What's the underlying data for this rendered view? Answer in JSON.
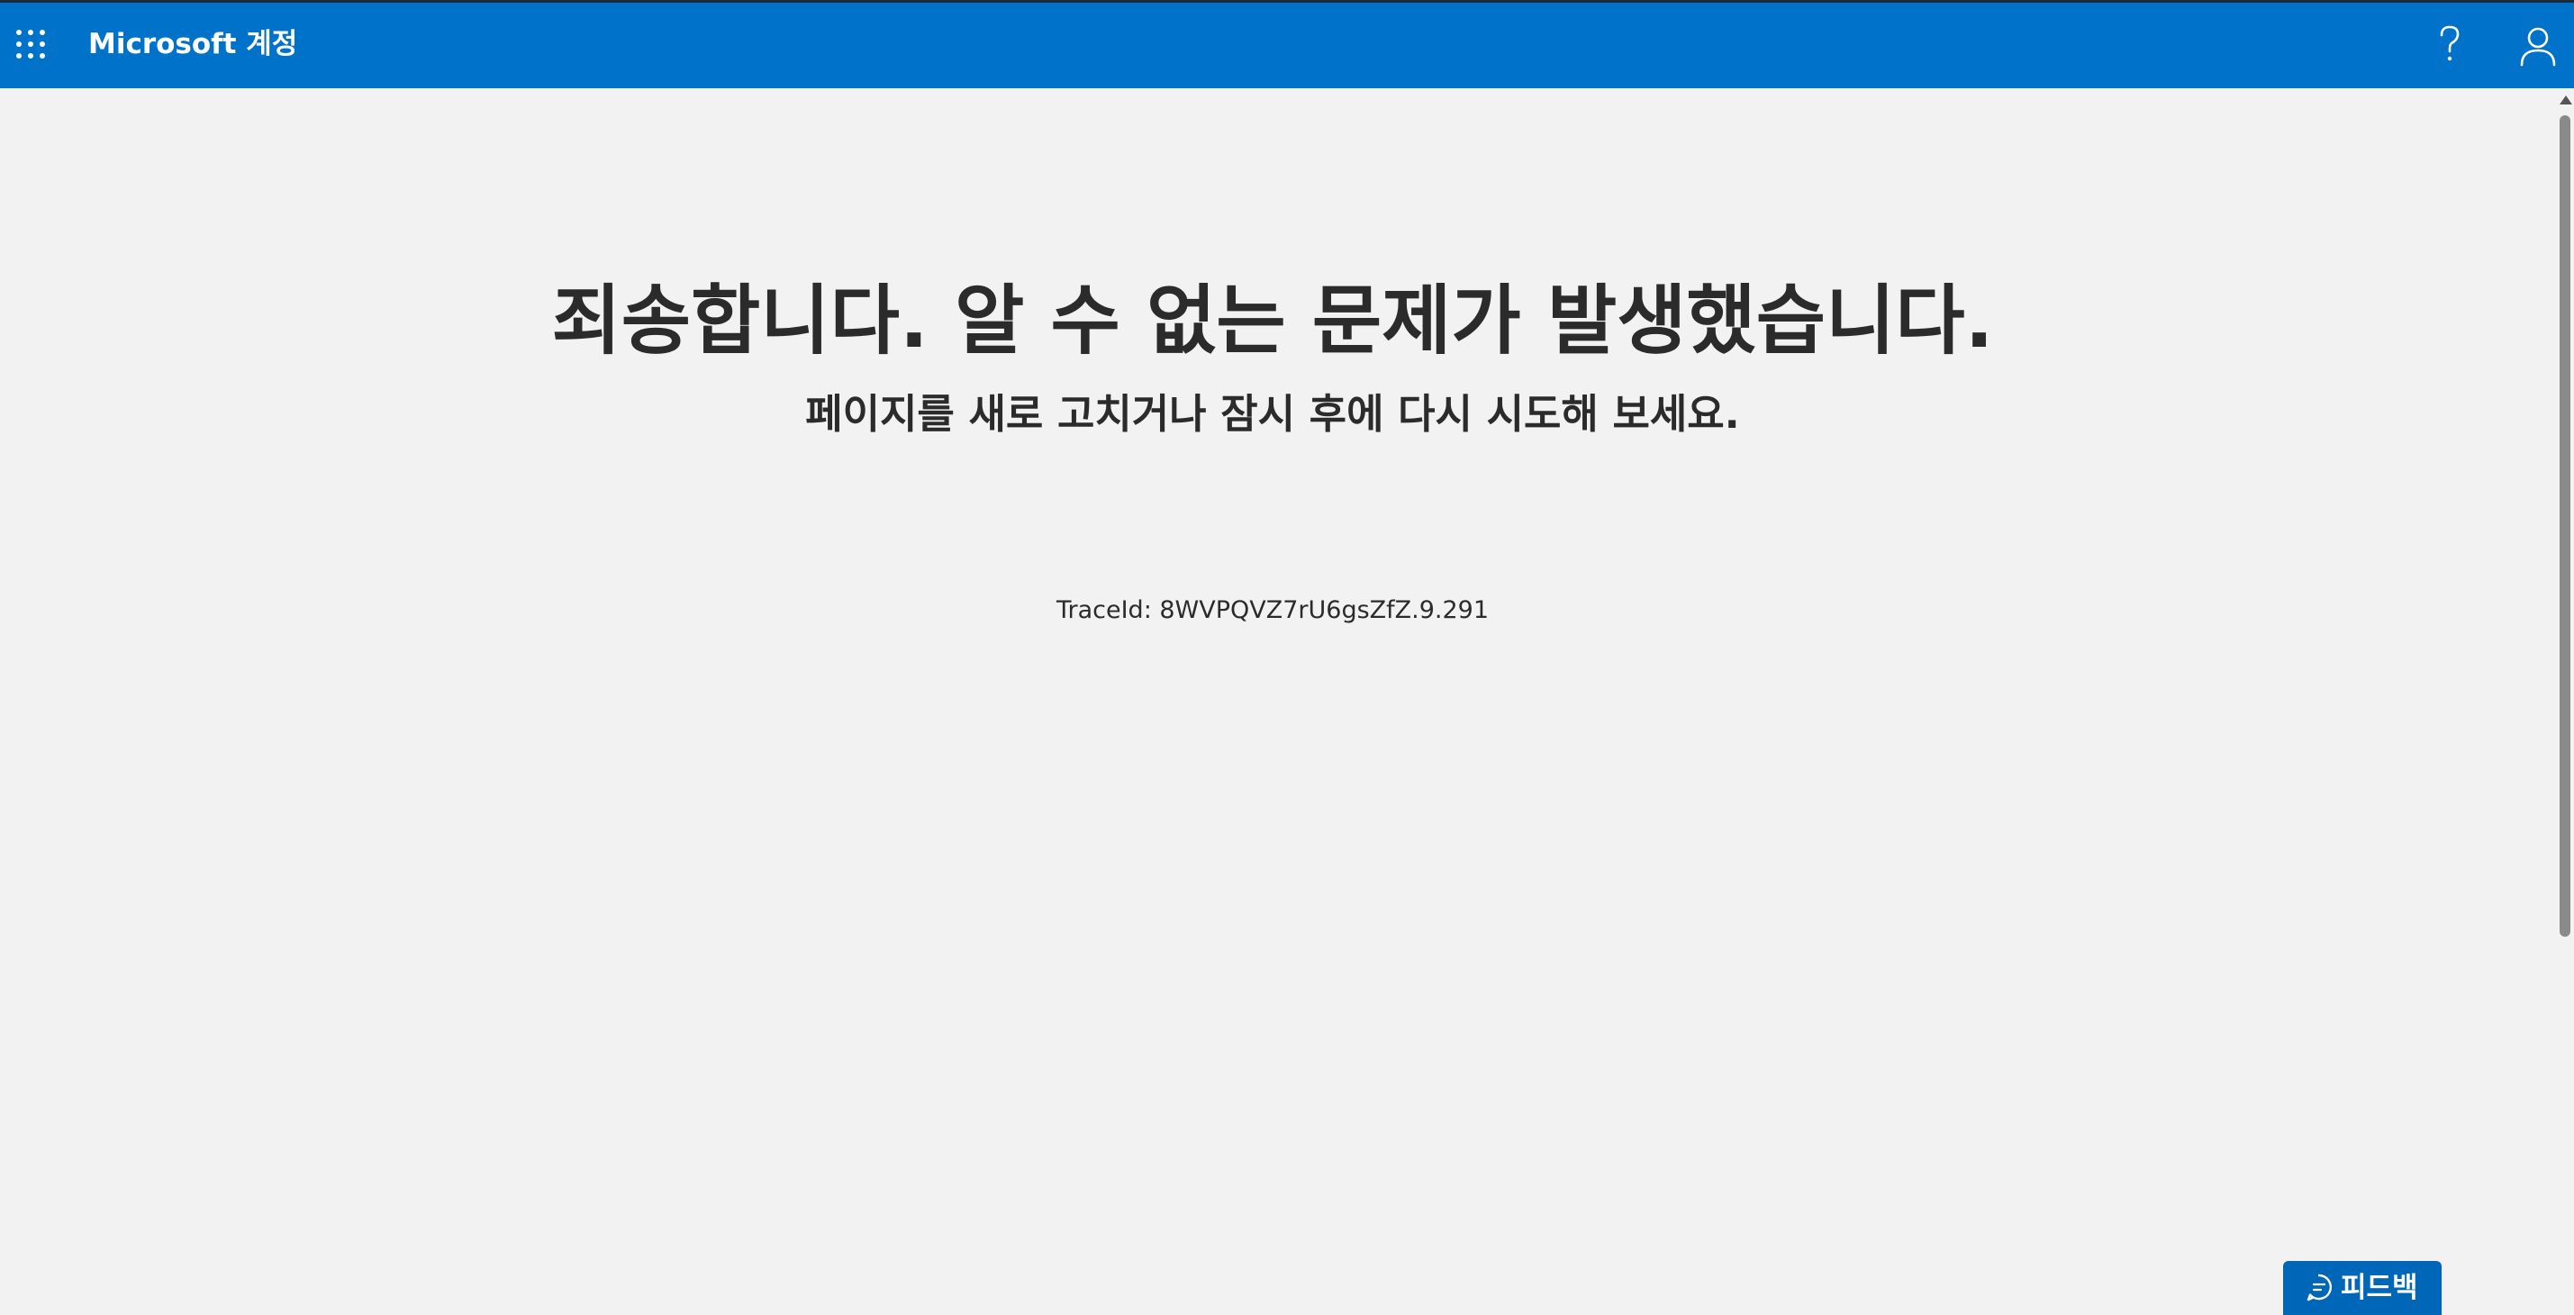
{
  "header": {
    "brand": "Microsoft 계정",
    "icons": [
      "app-launcher-icon",
      "help-icon",
      "user-account-icon"
    ]
  },
  "error": {
    "title": "죄송합니다. 알 수 없는 문제가 발생했습니다.",
    "subtitle": "페이지를 새로 고치거나 잠시 후에 다시 시도해 보세요.",
    "trace_id": "TraceId: 8WVPQVZ7rU6gsZfZ.9.291"
  },
  "feedback": {
    "label": "피드백"
  },
  "colors": {
    "header_bg": "#0072c9",
    "page_bg": "#f2f2f2",
    "text": "#2b2b2b",
    "feedback_bg": "#0067b8"
  }
}
